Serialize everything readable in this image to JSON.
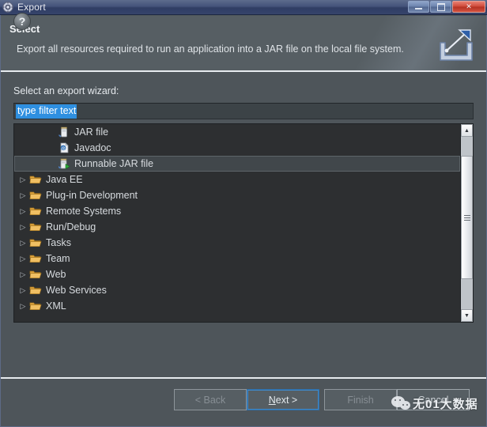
{
  "window": {
    "title": "Export",
    "icon": "export-gear-icon",
    "controls": [
      {
        "name": "minimize",
        "glyph": "minim"
      },
      {
        "name": "maximize",
        "glyph": "maxim"
      },
      {
        "name": "close",
        "glyph": "✕"
      }
    ]
  },
  "banner": {
    "title": "Select",
    "description": "Export all resources required to run an application into a JAR file on the local file system.",
    "icon": "export-arrow-icon"
  },
  "form": {
    "label": "Select an export wizard:",
    "filter": {
      "value": "type filter text",
      "placeholder": "type filter text",
      "selected": true
    }
  },
  "tree": {
    "items": [
      {
        "label": "JAR file",
        "icon": "jar-file-icon",
        "type": "leaf",
        "expandable": false,
        "selected": false,
        "indent": 1
      },
      {
        "label": "Javadoc",
        "icon": "javadoc-icon",
        "type": "leaf",
        "expandable": false,
        "selected": false,
        "indent": 1
      },
      {
        "label": "Runnable JAR file",
        "icon": "runnable-jar-icon",
        "type": "leaf",
        "expandable": false,
        "selected": true,
        "indent": 1
      },
      {
        "label": "Java EE",
        "icon": "folder-icon",
        "type": "folder",
        "expandable": true,
        "selected": false,
        "indent": 0
      },
      {
        "label": "Plug-in Development",
        "icon": "folder-icon",
        "type": "folder",
        "expandable": true,
        "selected": false,
        "indent": 0
      },
      {
        "label": "Remote Systems",
        "icon": "folder-icon",
        "type": "folder",
        "expandable": true,
        "selected": false,
        "indent": 0
      },
      {
        "label": "Run/Debug",
        "icon": "folder-icon",
        "type": "folder",
        "expandable": true,
        "selected": false,
        "indent": 0
      },
      {
        "label": "Tasks",
        "icon": "folder-icon",
        "type": "folder",
        "expandable": true,
        "selected": false,
        "indent": 0
      },
      {
        "label": "Team",
        "icon": "folder-icon",
        "type": "folder",
        "expandable": true,
        "selected": false,
        "indent": 0
      },
      {
        "label": "Web",
        "icon": "folder-icon",
        "type": "folder",
        "expandable": true,
        "selected": false,
        "indent": 0
      },
      {
        "label": "Web Services",
        "icon": "folder-icon",
        "type": "folder",
        "expandable": true,
        "selected": false,
        "indent": 0
      },
      {
        "label": "XML",
        "icon": "folder-icon",
        "type": "folder",
        "expandable": true,
        "selected": false,
        "indent": 0
      }
    ],
    "scrollbar": {
      "up_glyph": "▲",
      "down_glyph": "▼"
    }
  },
  "footer": {
    "help_glyph": "?",
    "buttons": [
      {
        "id": "back",
        "label": "< Back",
        "enabled": false,
        "focused": false,
        "mnemonic": ""
      },
      {
        "id": "next",
        "label": "Next >",
        "enabled": true,
        "focused": true,
        "mnemonic": "N"
      },
      {
        "id": "finish",
        "label": "Finish",
        "enabled": false,
        "focused": false,
        "mnemonic": ""
      },
      {
        "id": "cancel",
        "label": "Cancel",
        "enabled": true,
        "focused": false,
        "mnemonic": ""
      }
    ]
  },
  "watermark": {
    "text": "无01大数据",
    "logo": "wechat-logo-icon"
  },
  "colors": {
    "titlebar": "#44537a",
    "banner_bg": "#565e63",
    "dialog_bg": "#4e555a",
    "tree_bg": "#2d2f31",
    "selection_blue": "#2e8fe0",
    "focus_border": "#3f88c8",
    "close_red": "#cf4a39",
    "folder_orange": "#e8b257"
  }
}
